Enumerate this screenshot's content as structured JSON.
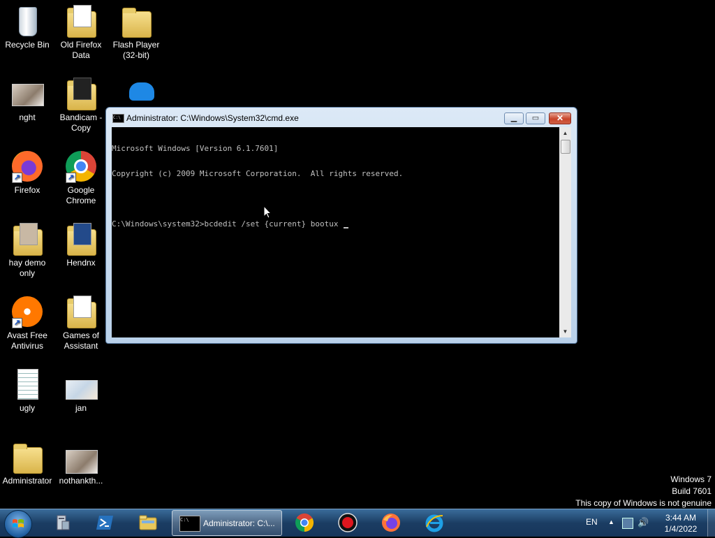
{
  "desktop": {
    "icons": [
      {
        "label": "Recycle Bin"
      },
      {
        "label": "Old Firefox Data"
      },
      {
        "label": "Flash Player (32-bit)"
      },
      {
        "label": "nght"
      },
      {
        "label": "Bandicam - Copy"
      },
      {
        "label": "Firefox"
      },
      {
        "label": "Google Chrome"
      },
      {
        "label": "hay demo only"
      },
      {
        "label": "Hendnx"
      },
      {
        "label": "Avast Free Antivirus"
      },
      {
        "label": "Games of Assistant"
      },
      {
        "label": "ugly"
      },
      {
        "label": "jan"
      },
      {
        "label": "Administrator"
      },
      {
        "label": "nothankth..."
      }
    ]
  },
  "cmd_window": {
    "title": "Administrator: C:\\Windows\\System32\\cmd.exe",
    "icon_text": "C:\\",
    "lines": [
      "Microsoft Windows [Version 6.1.7601]",
      "Copyright (c) 2009 Microsoft Corporation.  All rights reserved.",
      "",
      "C:\\Windows\\system32>bcdedit /set {current} bootux "
    ],
    "controls": {
      "minimize": "▁",
      "maximize": "▭",
      "close": "✕"
    }
  },
  "watermark": {
    "line1": "Windows 7",
    "line2": "Build 7601",
    "line3": "This copy of Windows is not genuine"
  },
  "taskbar": {
    "active_window_label": "Administrator: C:\\...",
    "pinned": [
      "server-manager",
      "powershell",
      "windows-explorer",
      "google-chrome",
      "bandicam",
      "firefox",
      "internet-explorer"
    ],
    "language": "EN",
    "clock_time": "3:44 AM",
    "clock_date": "1/4/2022"
  },
  "colors": {
    "console_bg": "#000000",
    "console_text": "#c0c0c0",
    "taskbar": "#1b3d63",
    "close_button": "#c8442a"
  }
}
